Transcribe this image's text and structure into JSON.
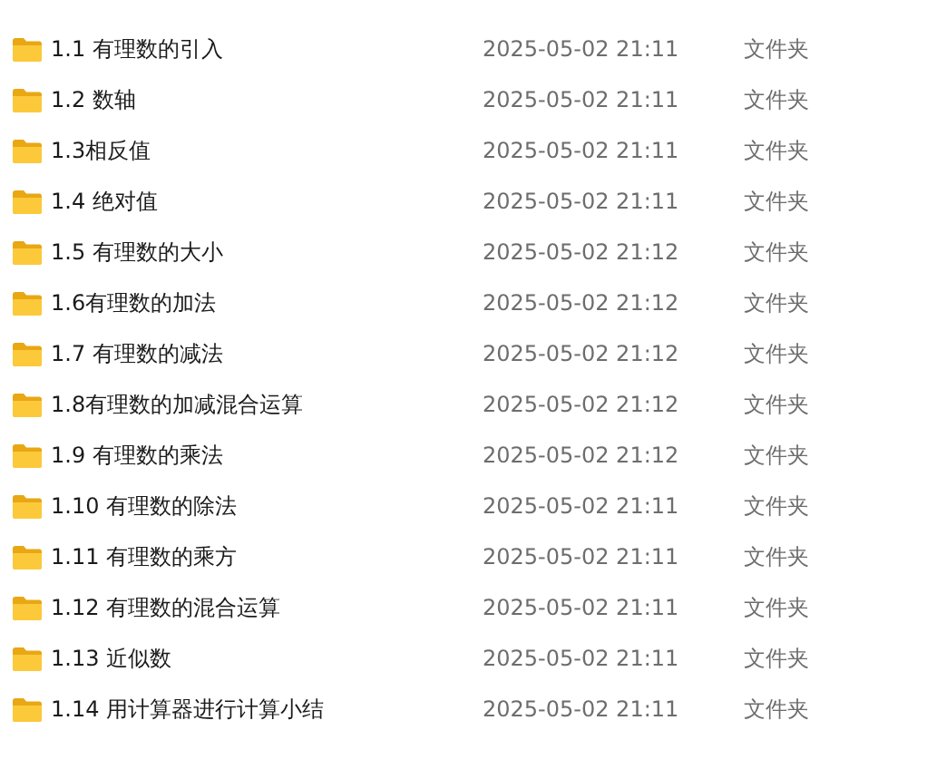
{
  "files": [
    {
      "name": "1.1 有理数的引入",
      "modified": "2025-05-02 21:11",
      "type": "文件夹"
    },
    {
      "name": "1.2 数轴",
      "modified": "2025-05-02 21:11",
      "type": "文件夹"
    },
    {
      "name": "1.3相反值",
      "modified": "2025-05-02 21:11",
      "type": "文件夹"
    },
    {
      "name": "1.4 绝对值",
      "modified": "2025-05-02 21:11",
      "type": "文件夹"
    },
    {
      "name": "1.5 有理数的大小",
      "modified": "2025-05-02 21:12",
      "type": "文件夹"
    },
    {
      "name": "1.6有理数的加法",
      "modified": "2025-05-02 21:12",
      "type": "文件夹"
    },
    {
      "name": "1.7 有理数的减法",
      "modified": "2025-05-02 21:12",
      "type": "文件夹"
    },
    {
      "name": "1.8有理数的加减混合运算",
      "modified": "2025-05-02 21:12",
      "type": "文件夹"
    },
    {
      "name": "1.9 有理数的乘法",
      "modified": "2025-05-02 21:12",
      "type": "文件夹"
    },
    {
      "name": "1.10 有理数的除法",
      "modified": "2025-05-02 21:11",
      "type": "文件夹"
    },
    {
      "name": "1.11 有理数的乘方",
      "modified": "2025-05-02 21:11",
      "type": "文件夹"
    },
    {
      "name": "1.12 有理数的混合运算",
      "modified": "2025-05-02 21:11",
      "type": "文件夹"
    },
    {
      "name": "1.13 近似数",
      "modified": "2025-05-02 21:11",
      "type": "文件夹"
    },
    {
      "name": "1.14 用计算器进行计算小结",
      "modified": "2025-05-02 21:11",
      "type": "文件夹"
    }
  ]
}
